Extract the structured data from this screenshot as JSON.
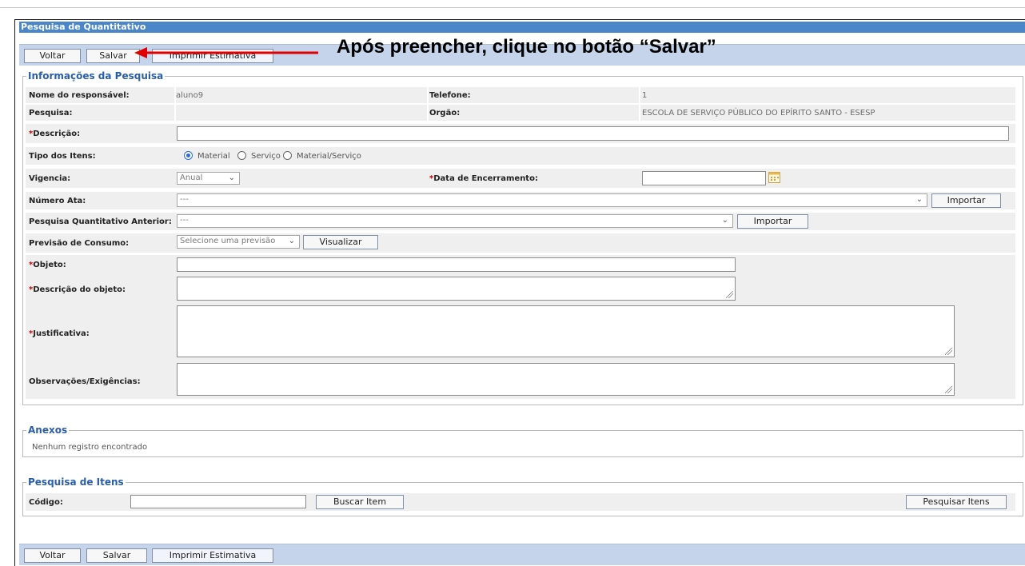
{
  "window": {
    "title": "Pesquisa de Quantitativo"
  },
  "toolbar": {
    "voltar": "Voltar",
    "salvar": "Salvar",
    "imprimir": "Imprimir Estimativa"
  },
  "annotation": {
    "text": "Após preencher, clique no botão “Salvar”",
    "color": "#e00000"
  },
  "info": {
    "legend": "Informações da Pesquisa",
    "responsavel_label": "Nome do responsável:",
    "responsavel_value": "aluno9",
    "telefone_label": "Telefone:",
    "telefone_value": "1",
    "pesquisa_label": "Pesquisa:",
    "orgao_label": "Orgão:",
    "orgao_value": "ESCOLA DE SERVIÇO PÚBLICO DO EPÍRITO SANTO - ESESP",
    "req": "*",
    "descricao_label": "Descrição:",
    "tipo_label": "Tipo dos Itens:",
    "tipo_opt_material": "Material",
    "tipo_opt_servico": "Serviço",
    "tipo_opt_ambos": "Material/Serviço",
    "tipo_selected": "Material",
    "vigencia_label": "Vigencia:",
    "vigencia_value": "Anual",
    "data_enc_label": "Data de Encerramento:",
    "numero_ata_label": "Número Ata:",
    "numero_ata_value": "---",
    "importar": "Importar",
    "pesquisa_ant_label": "Pesquisa Quantitativo Anterior:",
    "pesquisa_ant_value": "---",
    "previsao_label": "Previsão de Consumo:",
    "previsao_value": "Selecione uma previsão",
    "visualizar": "Visualizar",
    "objeto_label": "Objeto:",
    "descricao_objeto_label": "Descrição do objeto:",
    "justificativa_label": "Justificativa:",
    "observacoes_label": "Observações/Exigências:"
  },
  "anexos": {
    "legend": "Anexos",
    "empty": "Nenhum registro encontrado"
  },
  "itens": {
    "legend": "Pesquisa de Itens",
    "codigo_label": "Código:",
    "buscar": "Buscar Item",
    "pesquisar": "Pesquisar Itens"
  },
  "icons": {
    "calendar": "calendar-icon",
    "arrow": "arrow-left-icon"
  }
}
